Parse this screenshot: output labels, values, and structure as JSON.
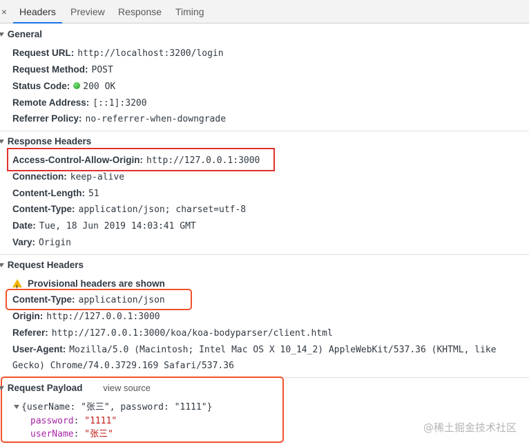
{
  "tabs": {
    "close": "×",
    "items": [
      {
        "label": "Headers",
        "active": true
      },
      {
        "label": "Preview",
        "active": false
      },
      {
        "label": "Response",
        "active": false
      },
      {
        "label": "Timing",
        "active": false
      }
    ]
  },
  "general": {
    "title": "General",
    "rows": [
      {
        "key": "Request URL:",
        "value": "http://localhost:3200/login"
      },
      {
        "key": "Request Method:",
        "value": "POST"
      },
      {
        "key": "Status Code:",
        "value": "200 OK"
      },
      {
        "key": "Remote Address:",
        "value": "[::1]:3200"
      },
      {
        "key": "Referrer Policy:",
        "value": "no-referrer-when-downgrade"
      }
    ]
  },
  "response_headers": {
    "title": "Response Headers",
    "rows": [
      {
        "key": "Access-Control-Allow-Origin:",
        "value": "http://127.0.0.1:3000"
      },
      {
        "key": "Connection:",
        "value": "keep-alive"
      },
      {
        "key": "Content-Length:",
        "value": "51"
      },
      {
        "key": "Content-Type:",
        "value": "application/json; charset=utf-8"
      },
      {
        "key": "Date:",
        "value": "Tue, 18 Jun 2019 14:03:41 GMT"
      },
      {
        "key": "Vary:",
        "value": "Origin"
      }
    ]
  },
  "request_headers": {
    "title": "Request Headers",
    "warning": "Provisional headers are shown",
    "rows": [
      {
        "key": "Content-Type:",
        "value": "application/json"
      },
      {
        "key": "Origin:",
        "value": "http://127.0.0.1:3000"
      },
      {
        "key": "Referer:",
        "value": "http://127.0.0.1:3000/koa/koa-bodyparser/client.html"
      },
      {
        "key": "User-Agent:",
        "value": "Mozilla/5.0 (Macintosh; Intel Mac OS X 10_14_2) AppleWebKit/537.36 (KHTML, like"
      }
    ],
    "user_agent_cont": "Gecko) Chrome/74.0.3729.169 Safari/537.36"
  },
  "payload": {
    "title": "Request Payload",
    "view_source": "view source",
    "summary": "{userName: \"张三\", password: \"1111\"}",
    "fields": [
      {
        "key": "password",
        "value": "\"1111\""
      },
      {
        "key": "userName",
        "value": "\"张三\""
      }
    ]
  },
  "watermark": "@稀土掘金技术社区",
  "colors": {
    "accent": "#1a73e8",
    "highlight_box": "#e0302b",
    "status_ok": "#1f9b1f"
  }
}
